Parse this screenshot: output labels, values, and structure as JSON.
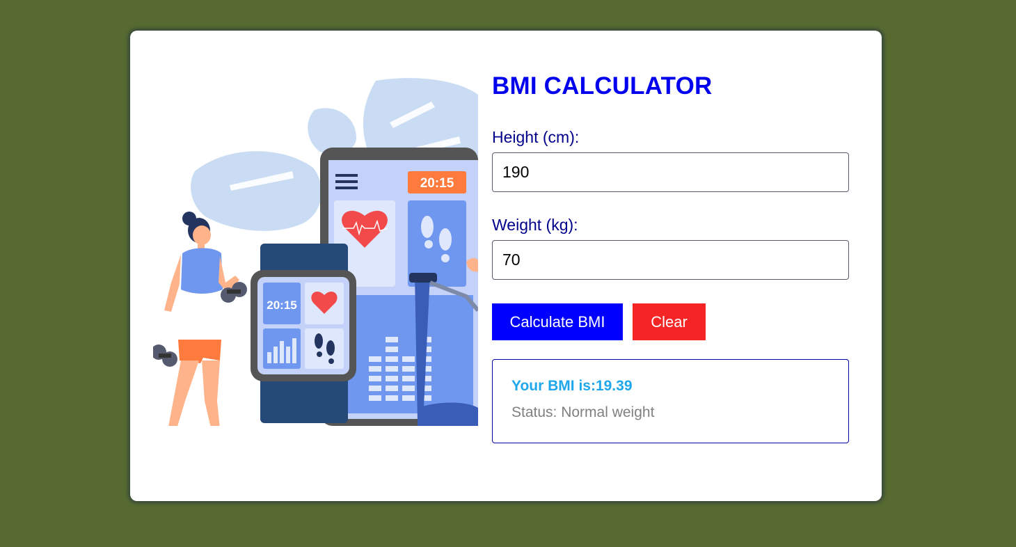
{
  "title": "BMI CALCULATOR",
  "height_field": {
    "label": "Height (cm):",
    "value": "190"
  },
  "weight_field": {
    "label": "Weight (kg):",
    "value": "70"
  },
  "buttons": {
    "calculate": "Calculate BMI",
    "clear": "Clear"
  },
  "result": {
    "bmi_prefix": "Your BMI is:",
    "bmi_value": "19.39",
    "status_prefix": "Status: ",
    "status_value": "Normal weight"
  },
  "illustration": {
    "phone_time": "20:15",
    "watch_time": "20:15"
  },
  "colors": {
    "background": "#576b31",
    "title": "#0000ee",
    "label": "#00008b",
    "calculate_button": "#0000ff",
    "clear_button": "#f52525",
    "bmi_text": "#1ea7ea",
    "status_text": "#808080"
  }
}
